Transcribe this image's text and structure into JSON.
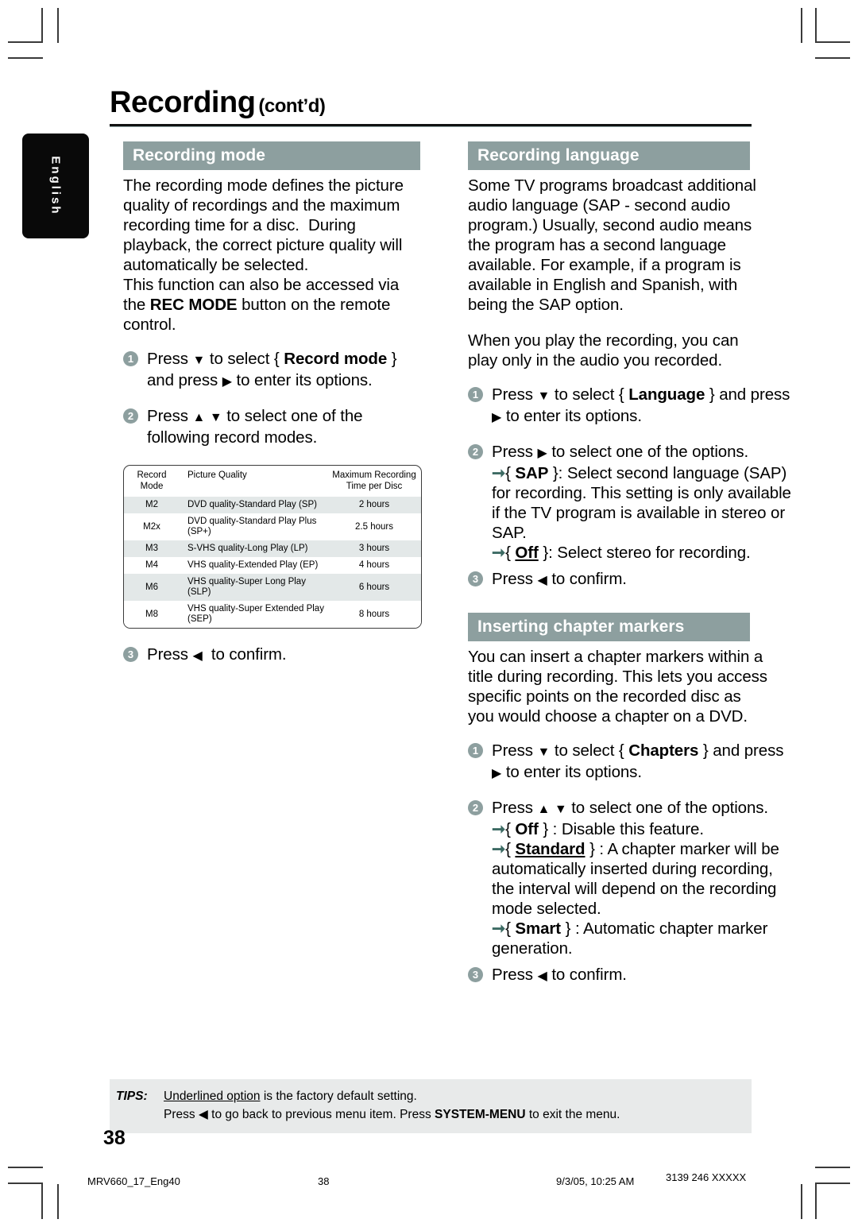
{
  "header": {
    "title": "Recording",
    "title_suffix": "(cont’d)"
  },
  "language_tab": {
    "label": "English"
  },
  "left_column": {
    "section_title": "Recording mode",
    "paragraphs": [
      "The recording mode defines the picture quality of recordings and the maximum recording time for a disc.  During playback, the correct picture quality will automatically be selected.",
      "This function can also be accessed via the REC MODE button on the remote control."
    ],
    "steps": [
      {
        "number": "1",
        "text": "Press ▼ to select { Record mode } and press ▶ to enter its options."
      },
      {
        "number": "2",
        "text": "Press ▲ ▼ to select one of the following record modes."
      },
      {
        "number": "3",
        "text": "Press ◀ to confirm."
      }
    ]
  },
  "record_mode_table": {
    "columns": [
      "Record Mode",
      "Picture Quality",
      "Maximum Recording Time per Disc"
    ],
    "column_header_lines": [
      [
        "Record",
        "Mode"
      ],
      [
        "Picture Quality",
        ""
      ],
      [
        "Maximum Recording",
        "Time per Disc"
      ]
    ],
    "rows": [
      {
        "mode": "M2",
        "quality": "DVD quality-Standard Play (SP)",
        "time": "2 hours"
      },
      {
        "mode": "M2x",
        "quality": "DVD quality-Standard Play Plus (SP+)",
        "time": "2.5 hours"
      },
      {
        "mode": "M3",
        "quality": "S-VHS quality-Long Play (LP)",
        "time": "3 hours"
      },
      {
        "mode": "M4",
        "quality": "VHS quality-Extended Play (EP)",
        "time": "4 hours"
      },
      {
        "mode": "M6",
        "quality": "VHS quality-Super Long Play (SLP)",
        "time": "6 hours"
      },
      {
        "mode": "M8",
        "quality": "VHS quality-Super Extended Play (SEP)",
        "time": "8 hours"
      }
    ]
  },
  "right_column": {
    "section_language": {
      "section_title": "Recording language",
      "paragraphs": [
        "Some TV programs broadcast additional audio language (SAP - second audio program.) Usually, second audio means the program has a second language available. For example, if a program is available in English and Spanish, with being the SAP option.",
        "When you play the recording, you can play only in the audio you recorded."
      ],
      "steps": [
        {
          "number": "1",
          "text": "Press ▼ to select { Language } and press ▶ to enter its options."
        },
        {
          "number": "2",
          "text": "Press ▶ to select one of the options."
        },
        {
          "number": "3",
          "text": "Press ◀ to confirm."
        }
      ],
      "options": [
        {
          "name": "SAP",
          "underlined": false,
          "description": ":  Select second language (SAP) for recording. This setting is only available if the TV program is available in stereo or SAP."
        },
        {
          "name": "Off",
          "underlined": true,
          "description": ":  Select stereo for recording."
        }
      ]
    },
    "section_chapters": {
      "section_title": "Inserting chapter markers",
      "paragraphs": [
        "You can insert a chapter markers within a title during recording. This lets you access specific points on the recorded disc as you would choose a chapter on a DVD."
      ],
      "steps": [
        {
          "number": "1",
          "text": "Press ▼ to select { Chapters } and press ▶ to enter its options."
        },
        {
          "number": "2",
          "text": "Press ▲ ▼ to select one of the options."
        },
        {
          "number": "3",
          "text": "Press ◀ to confirm."
        }
      ],
      "options": [
        {
          "name": "Off",
          "underlined": false,
          "description": " :  Disable this feature."
        },
        {
          "name": "Standard",
          "underlined": true,
          "description": " : A chapter marker will be automatically inserted during recording, the interval will depend on the recording mode selected."
        },
        {
          "name": "Smart",
          "underlined": false,
          "description": " : Automatic chapter marker generation."
        }
      ]
    }
  },
  "tips": {
    "label": "TIPS:",
    "line1_underlined": "Underlined option",
    "line1_rest": " is the factory default setting.",
    "line2_pre": "Press ◀ to go back to previous menu item.  Press ",
    "line2_bold": "SYSTEM-MENU",
    "line2_post": " to exit the menu."
  },
  "page_number": "38",
  "footer": {
    "file_name": "MRV660_17_Eng40",
    "page": "38",
    "date_time": "9/3/05, 10:25 AM",
    "doc_code": "3139 246 XXXXX"
  },
  "colors": {
    "section_header_bg": "#8d9f9f",
    "step_bullet_bg": "#8d9f9f",
    "arrow_marker": "#3c6a63",
    "table_row_alt": "#e3e8e8",
    "tips_bg": "#e8eaea",
    "tab_bg": "#090909"
  }
}
